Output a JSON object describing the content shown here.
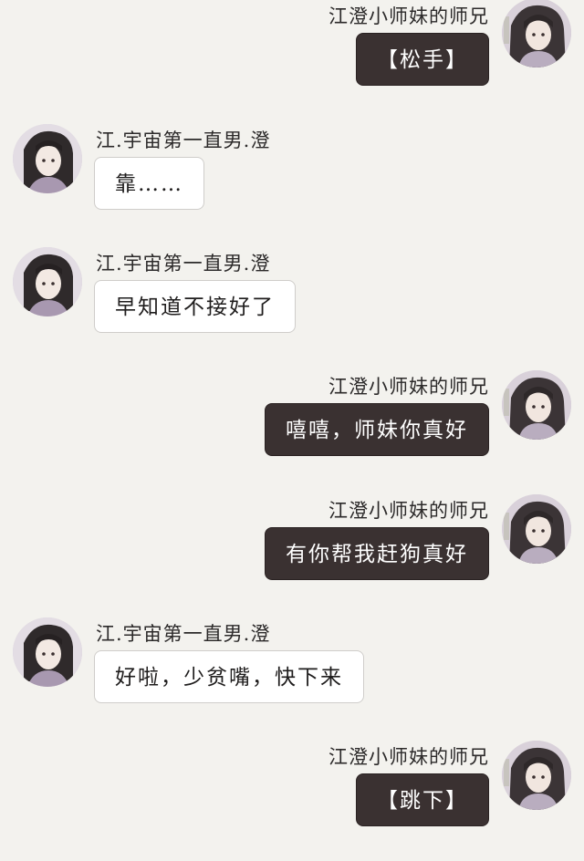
{
  "users": {
    "self_name": "江澄小师妹的师兄",
    "other_name": "江.宇宙第一直男.澄"
  },
  "messages": [
    {
      "side": "right",
      "name": "江澄小师妹的师兄",
      "text": "【松手】"
    },
    {
      "side": "left",
      "name": "江.宇宙第一直男.澄",
      "text": "靠……"
    },
    {
      "side": "left",
      "name": "江.宇宙第一直男.澄",
      "text": "早知道不接好了"
    },
    {
      "side": "right",
      "name": "江澄小师妹的师兄",
      "text": "嘻嘻，师妹你真好"
    },
    {
      "side": "right",
      "name": "江澄小师妹的师兄",
      "text": "有你帮我赶狗真好"
    },
    {
      "side": "left",
      "name": "江.宇宙第一直男.澄",
      "text": "好啦，少贫嘴，快下来"
    },
    {
      "side": "right",
      "name": "江澄小师妹的师兄",
      "text": "【跳下】"
    }
  ],
  "colors": {
    "background": "#f3f2ee",
    "self_bubble": "#3a3131",
    "other_bubble": "#ffffff"
  },
  "icons": {
    "self_avatar": "character-portrait-icon",
    "other_avatar": "character-portrait-icon"
  }
}
